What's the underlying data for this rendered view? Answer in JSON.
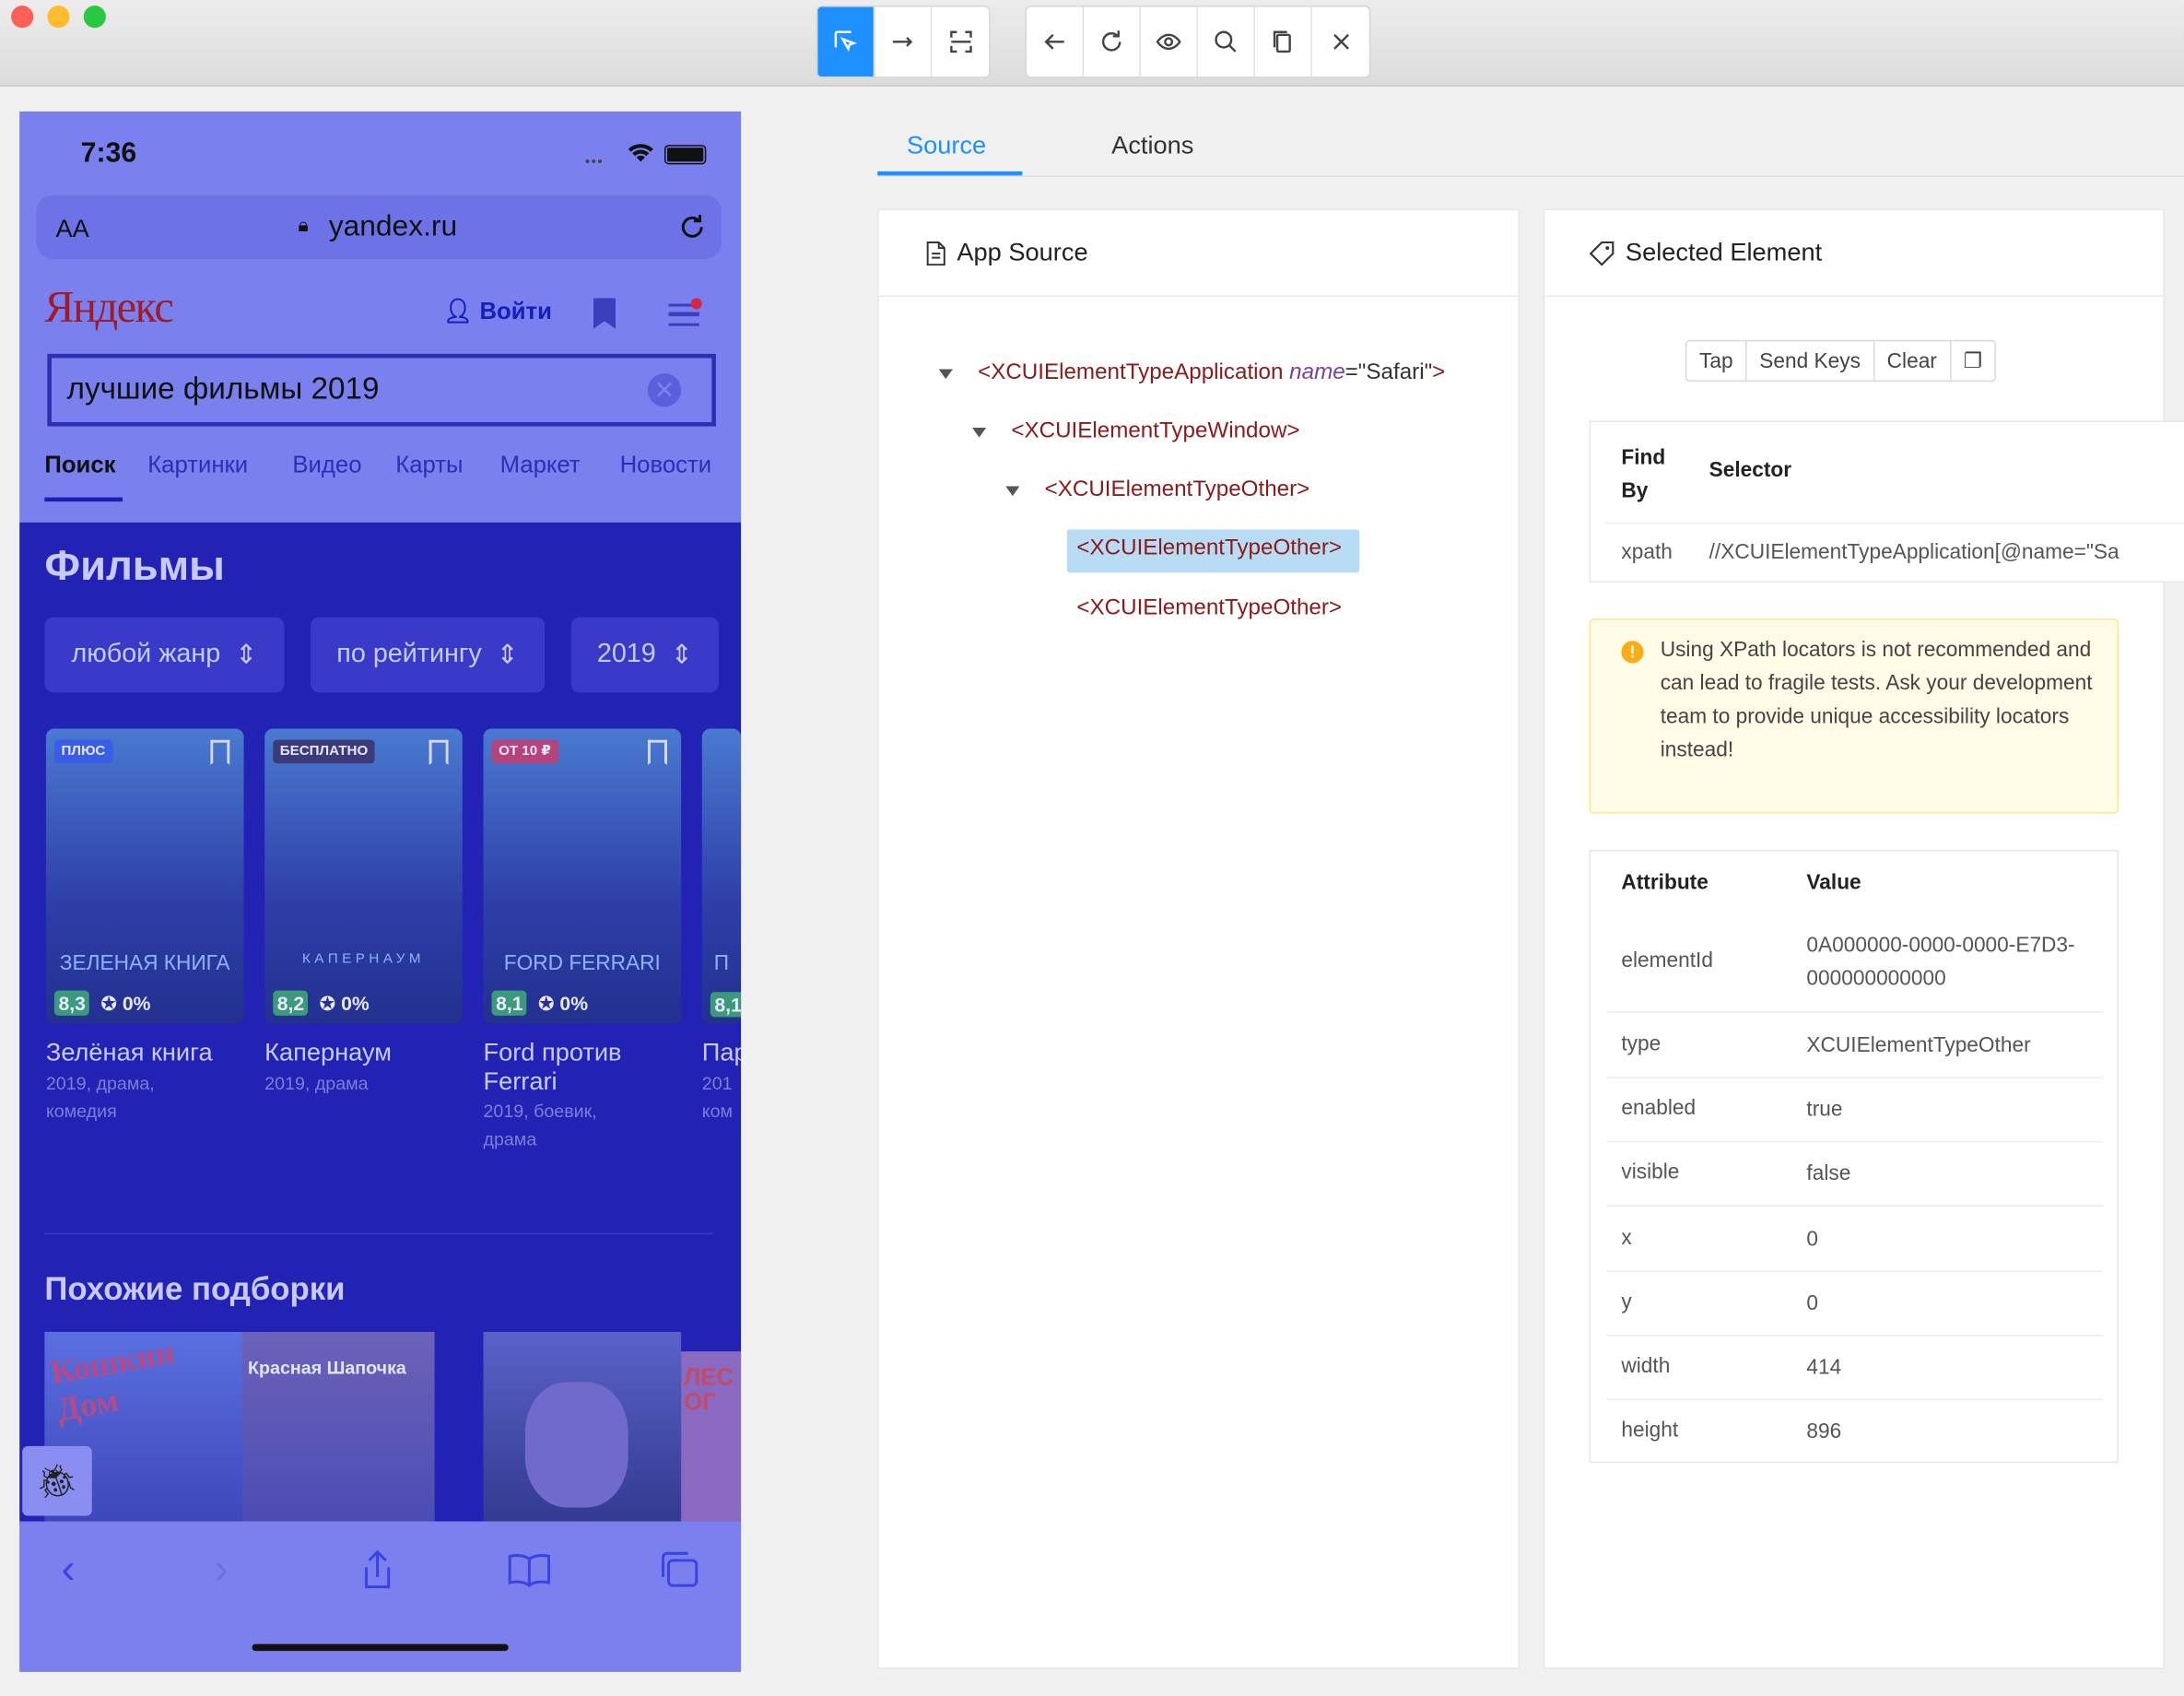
{
  "toolbar": {
    "group1": [
      "select-icon",
      "swipe-icon",
      "tap-area-icon"
    ],
    "group2": [
      "back-icon",
      "refresh-icon",
      "eye-icon",
      "search-icon",
      "copy-icon",
      "close-icon"
    ]
  },
  "phone": {
    "time": "7:36",
    "url": "yandex.ru",
    "text_size": "AA",
    "logo": "Яндекс",
    "login": "Войти",
    "query": "лучшие фильмы 2019",
    "tabs": [
      "Поиск",
      "Картинки",
      "Видео",
      "Карты",
      "Маркет",
      "Новости"
    ],
    "section_title": "Фильмы",
    "filters": [
      "любой жанр",
      "по рейтингу",
      "2019"
    ],
    "cards": [
      {
        "tag": "ПЛЮС",
        "tag_color": "#3a5de8",
        "poster_text": "ЗЕЛЕНАЯ КНИГА",
        "rating": "8,3",
        "percent": "0%",
        "title": "Зелёная книга",
        "sub": "2019, драма, комедия"
      },
      {
        "tag": "БЕСПЛАТНО",
        "tag_color": "#3b3b7a",
        "poster_text": "КАПЕРНАУМ",
        "rating": "8,2",
        "percent": "0%",
        "title": "Капернаум",
        "sub": "2019, драма"
      },
      {
        "tag": "ОТ 10 ₽",
        "tag_color": "#b5447a",
        "poster_text": "FORD FERRARI",
        "rating": "8,1",
        "percent": "0%",
        "title": "Ford против Ferrari",
        "sub": "2019, боевик, драма"
      },
      {
        "tag": "",
        "tag_color": "",
        "poster_text": "П",
        "rating": "8,1",
        "percent": "",
        "title": "Пар",
        "sub": "201 ком"
      }
    ],
    "similar_title": "Похожие подборки",
    "similar_posters": [
      "Кошкин Дом",
      "Красная Шапочка",
      "",
      "ЛЕС ОГ"
    ]
  },
  "tabs": {
    "source": "Source",
    "actions": "Actions"
  },
  "app_source": {
    "title": "App Source",
    "nodes": [
      {
        "tag": "<XCUIElementTypeApplication",
        "attr": "name",
        "eq": "=",
        "val": "\"Safari\"",
        "close": ">"
      },
      {
        "tag": "<XCUIElementTypeWindow>"
      },
      {
        "tag": "<XCUIElementTypeOther>"
      },
      {
        "tag": "<XCUIElementTypeOther>"
      },
      {
        "tag": "<XCUIElementTypeOther>"
      }
    ]
  },
  "selected": {
    "title": "Selected Element",
    "buttons": [
      "Tap",
      "Send Keys",
      "Clear"
    ],
    "find_by_header": [
      "Find By",
      "Selector"
    ],
    "find_by": {
      "key": "xpath",
      "value": "//XCUIElementTypeApplication[@name=\"Sa"
    },
    "warning": "Using XPath locators is not recommended and can lead to fragile tests. Ask your development team to provide unique accessibility locators instead!",
    "attr_header": [
      "Attribute",
      "Value"
    ],
    "attributes": [
      {
        "k": "elementId",
        "v": "0A000000-0000-0000-E7D3-000000000000"
      },
      {
        "k": "type",
        "v": "XCUIElementTypeOther"
      },
      {
        "k": "enabled",
        "v": "true"
      },
      {
        "k": "visible",
        "v": "false"
      },
      {
        "k": "x",
        "v": "0"
      },
      {
        "k": "y",
        "v": "0"
      },
      {
        "k": "width",
        "v": "414"
      },
      {
        "k": "height",
        "v": "896"
      }
    ]
  },
  "colors": {
    "accent": "#1e90ff",
    "highlight": "#b9dcf5",
    "overlay": "#7a80ee",
    "xml_tag": "#8b1a1a"
  }
}
